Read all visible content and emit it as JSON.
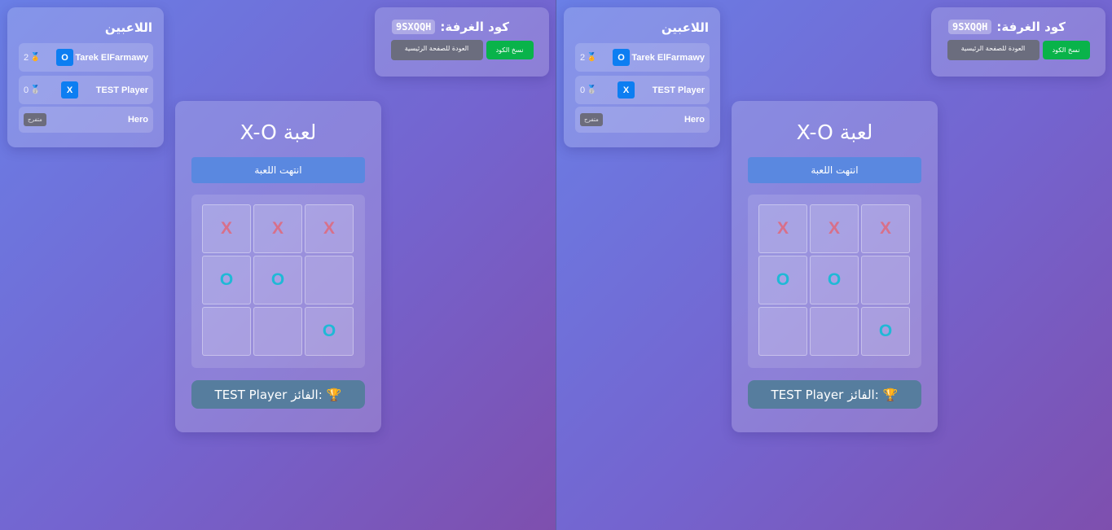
{
  "players_panel": {
    "title": "اللاعبين",
    "players": [
      {
        "name": "Tarek ElFarmawy",
        "symbol": "O",
        "score": "2",
        "medal": "gold"
      },
      {
        "name": "TEST Player",
        "symbol": "X",
        "score": "0",
        "medal": "silver"
      }
    ],
    "spectator": {
      "name": "Hero",
      "role_label": "متفرج"
    }
  },
  "room": {
    "label": "كود الغرفة:",
    "code": "9SXQQH",
    "copy_button": "نسخ الكود",
    "home_button": "العودة للصفحة الرئيسية"
  },
  "game": {
    "title": "لعبة X-O",
    "status": "انتهت اللعبة",
    "board": [
      "X",
      "X",
      "X",
      "O",
      "O",
      "",
      "",
      "",
      "O"
    ],
    "winner_label": "الفائز:",
    "winner_name": "TEST Player",
    "trophy_icon": "🏆"
  },
  "colors": {
    "x_mark": "#d8708a",
    "o_mark": "#1fb9d6",
    "symbol_badge": "#0d7ef2",
    "copy_button": "#09b34a",
    "status_bar": "#5a88e0"
  }
}
